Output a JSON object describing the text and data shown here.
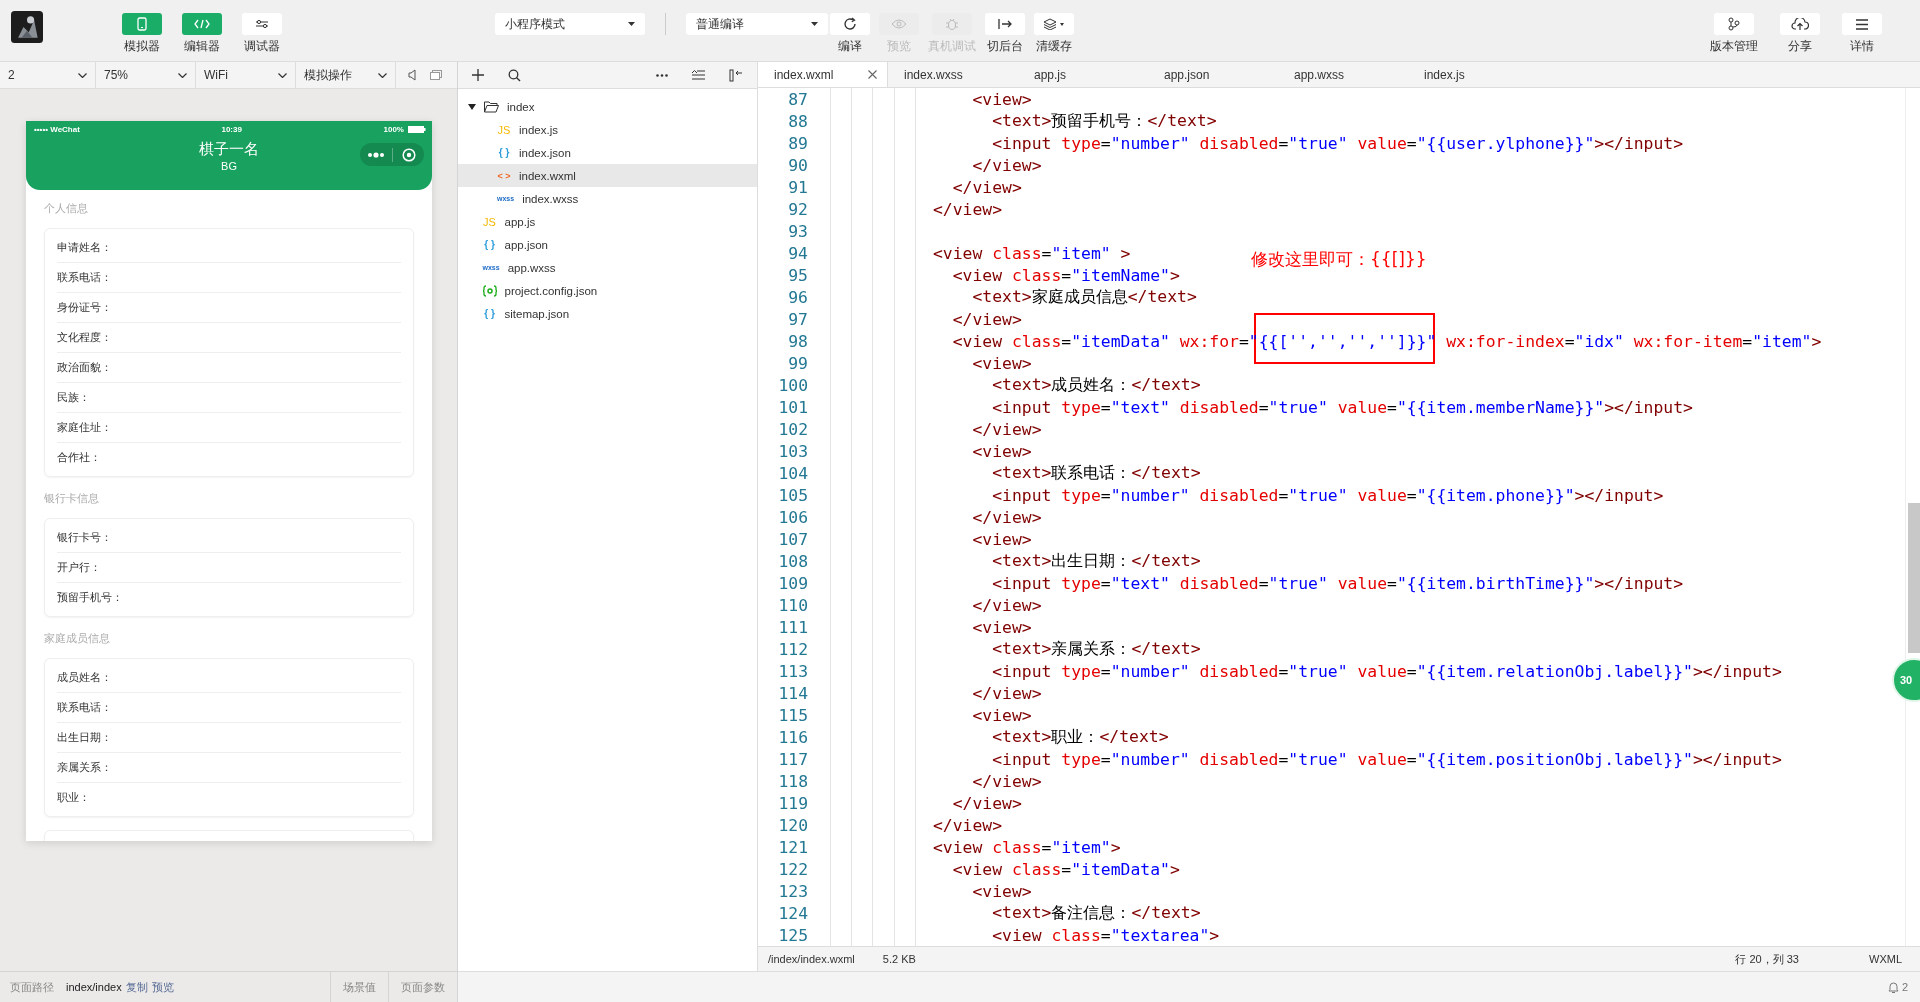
{
  "toolbar": {
    "view_toggles": [
      {
        "label": "模拟器",
        "selected": true
      },
      {
        "label": "编辑器",
        "selected": true
      },
      {
        "label": "调试器",
        "selected": false
      }
    ],
    "mode_select": "小程序模式",
    "compile_select": "普通编译",
    "actions": [
      {
        "label": "编译",
        "disabled": false
      },
      {
        "label": "预览",
        "disabled": true
      },
      {
        "label": "真机调试",
        "disabled": true
      },
      {
        "label": "切后台",
        "disabled": false
      },
      {
        "label": "清缓存",
        "disabled": false
      }
    ],
    "right_actions": [
      {
        "label": "版本管理"
      },
      {
        "label": "分享"
      },
      {
        "label": "详情"
      }
    ]
  },
  "simulator": {
    "controls": [
      "2",
      "75%",
      "WiFi",
      "模拟操作"
    ],
    "phone": {
      "carrier": "••••• WeChat",
      "time": "10:39",
      "battery": "100%",
      "title": "棋子一名",
      "subtitle": "BG",
      "sections": [
        {
          "title": "个人信息",
          "fields": [
            "申请姓名：",
            "联系电话：",
            "身份证号：",
            "文化程度：",
            "政治面貌：",
            "民族：",
            "家庭住址：",
            "合作社："
          ]
        },
        {
          "title": "银行卡信息",
          "fields": [
            "银行卡号：",
            "开户行：",
            "预留手机号："
          ]
        },
        {
          "title": "家庭成员信息",
          "fields": [
            "成员姓名：",
            "联系电话：",
            "出生日期：",
            "亲属关系：",
            "职业："
          ]
        }
      ]
    },
    "bottom_bar": {
      "path_label": "页面路径",
      "path": "index/index",
      "links": [
        "复制",
        "预览"
      ],
      "tabs": [
        "场景值",
        "页面参数"
      ]
    }
  },
  "file_tree": {
    "items": [
      {
        "name": "index",
        "kind": "folder",
        "expanded": true,
        "selected": false,
        "children": [
          {
            "name": "index.js",
            "kind": "js",
            "icon": "JS",
            "selected": false
          },
          {
            "name": "index.json",
            "kind": "json",
            "icon": "{ }",
            "selected": false
          },
          {
            "name": "index.wxml",
            "kind": "wxml",
            "icon": "< >",
            "selected": true
          },
          {
            "name": "index.wxss",
            "kind": "wxss",
            "icon": "wxss",
            "selected": false
          }
        ]
      },
      {
        "name": "app.js",
        "kind": "js",
        "icon": "JS",
        "selected": false
      },
      {
        "name": "app.json",
        "kind": "json",
        "icon": "{ }",
        "selected": false
      },
      {
        "name": "app.wxss",
        "kind": "wxss",
        "icon": "wxss",
        "selected": false
      },
      {
        "name": "project.config.json",
        "kind": "config",
        "selected": false
      },
      {
        "name": "sitemap.json",
        "kind": "json",
        "icon": "{ }",
        "selected": false
      }
    ]
  },
  "editor": {
    "tabs": [
      {
        "label": "index.wxml",
        "selected": true
      },
      {
        "label": "index.wxss",
        "selected": false
      },
      {
        "label": "app.js",
        "selected": false
      },
      {
        "label": "app.json",
        "selected": false
      },
      {
        "label": "app.wxss",
        "selected": false
      },
      {
        "label": "index.js",
        "selected": false
      }
    ],
    "lines": [
      {
        "number": "87",
        "code": "    <view>"
      },
      {
        "number": "88",
        "code": "      <text>预留手机号：</text>"
      },
      {
        "number": "89",
        "code": "      <input type=\"number\" disabled=\"true\" value=\"{{user.ylphone}}\"></input>"
      },
      {
        "number": "90",
        "code": "    </view>"
      },
      {
        "number": "91",
        "code": "  </view>"
      },
      {
        "number": "92",
        "code": "</view>"
      },
      {
        "number": "93"
      },
      {
        "number": "94",
        "code": "<view class=\"item\" >"
      },
      {
        "number": "95",
        "code": "  <view class=\"itemName\">"
      },
      {
        "number": "96",
        "code": "    <text>家庭成员信息</text>"
      },
      {
        "number": "97",
        "code": "  </view>"
      },
      {
        "number": "98",
        "code": "  <view class=\"itemData\" wx:for=\"{{['','','','']}}\" wx:for-index=\"idx\" wx:for-item=\"item\">"
      },
      {
        "number": "99",
        "code": "    <view>"
      },
      {
        "number": "100",
        "code": "      <text>成员姓名：</text>"
      },
      {
        "number": "101",
        "code": "      <input type=\"text\" disabled=\"true\" value=\"{{item.memberName}}\"></input>"
      },
      {
        "number": "102",
        "code": "    </view>"
      },
      {
        "number": "103",
        "code": "    <view>"
      },
      {
        "number": "104",
        "code": "      <text>联系电话：</text>"
      },
      {
        "number": "105",
        "code": "      <input type=\"number\" disabled=\"true\" value=\"{{item.phone}}\"></input>"
      },
      {
        "number": "106",
        "code": "    </view>"
      },
      {
        "number": "107",
        "code": "    <view>"
      },
      {
        "number": "108",
        "code": "      <text>出生日期：</text>"
      },
      {
        "number": "109",
        "code": "      <input type=\"text\" disabled=\"true\" value=\"{{item.birthTime}}\"></input>"
      },
      {
        "number": "110",
        "code": "    </view>"
      },
      {
        "number": "111",
        "code": "    <view>"
      },
      {
        "number": "112",
        "code": "      <text>亲属关系：</text>"
      },
      {
        "number": "113",
        "code": "      <input type=\"number\" disabled=\"true\" value=\"{{item.relationObj.label}}\"></input>"
      },
      {
        "number": "114",
        "code": "    </view>"
      },
      {
        "number": "115",
        "code": "    <view>"
      },
      {
        "number": "116",
        "code": "      <text>职业：</text>"
      },
      {
        "number": "117",
        "code": "      <input type=\"number\" disabled=\"true\" value=\"{{item.positionObj.label}}\"></input>"
      },
      {
        "number": "118",
        "code": "    </view>"
      },
      {
        "number": "119",
        "code": "  </view>"
      },
      {
        "number": "120",
        "code": "</view>"
      },
      {
        "number": "121",
        "code": "<view class=\"item\">"
      },
      {
        "number": "122",
        "code": "  <view class=\"itemData\">"
      },
      {
        "number": "123",
        "code": "    <view>"
      },
      {
        "number": "124",
        "code": "      <text>备注信息：</text>"
      },
      {
        "number": "125",
        "code": "      <view class=\"textarea\">"
      }
    ],
    "note": "修改这里即可：{{[]}}",
    "side_badge": "30",
    "status": {
      "path": "/index/index.wxml",
      "size": "5.2 KB",
      "cursor": "行 20，列 33",
      "language": "WXML"
    }
  },
  "notifications": {
    "count": "2"
  }
}
